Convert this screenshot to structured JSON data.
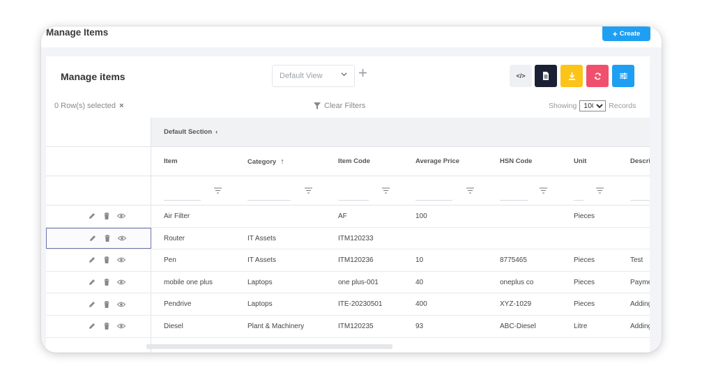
{
  "header": {
    "title": "Manage Items",
    "create_label": "Create"
  },
  "card": {
    "title": "Manage items",
    "view_select": "Default View",
    "rows_selected": "0 Row(s) selected",
    "clear_filters": "Clear Filters",
    "showing_label": "Showing",
    "records_value": "100",
    "records_label": "Records"
  },
  "toolbar": {
    "code_label": "</>"
  },
  "section": {
    "label": "Default Section"
  },
  "columns": [
    "Item",
    "Category",
    "Item Code",
    "Average Price",
    "HSN Code",
    "Unit",
    "Descrip"
  ],
  "rows": [
    {
      "item": "Air Filter",
      "category": "",
      "code": "AF",
      "price": "100",
      "hsn": "",
      "unit": "Pieces",
      "desc": ""
    },
    {
      "item": "Router",
      "category": "IT Assets",
      "code": "ITM120233",
      "price": "",
      "hsn": "",
      "unit": "",
      "desc": ""
    },
    {
      "item": "Pen",
      "category": "IT Assets",
      "code": "ITM120236",
      "price": "10",
      "hsn": "8775465",
      "unit": "Pieces",
      "desc": "Test"
    },
    {
      "item": "mobile one plus",
      "category": "Laptops",
      "code": "one plus-001",
      "price": "40",
      "hsn": "oneplus co",
      "unit": "Pieces",
      "desc": "Payme"
    },
    {
      "item": "Pendrive",
      "category": "Laptops",
      "code": "ITE-20230501",
      "price": "400",
      "hsn": "XYZ-1029",
      "unit": "Pieces",
      "desc": "Adding"
    },
    {
      "item": "Diesel",
      "category": "Plant & Machinery",
      "code": "ITM120235",
      "price": "93",
      "hsn": "ABC-Diesel",
      "unit": "Litre",
      "desc": "Adding"
    }
  ]
}
